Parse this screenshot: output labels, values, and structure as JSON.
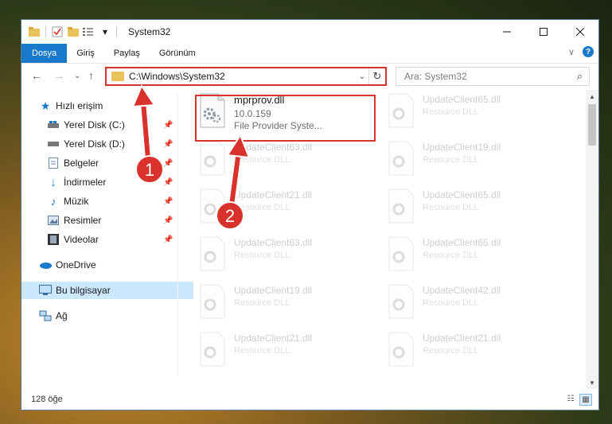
{
  "window": {
    "title": "System32"
  },
  "ribbon": {
    "tabs": [
      {
        "label": "Dosya"
      },
      {
        "label": "Giriş"
      },
      {
        "label": "Paylaş"
      },
      {
        "label": "Görünüm"
      }
    ],
    "help": "?"
  },
  "address": {
    "path": "C:\\Windows\\System32"
  },
  "search": {
    "placeholder": "Ara: System32"
  },
  "sidebar": {
    "quick_access": "Hızlı erişim",
    "items": [
      {
        "label": "Yerel Disk (C:)"
      },
      {
        "label": "Yerel Disk (D:)"
      },
      {
        "label": "Belgeler"
      },
      {
        "label": "İndirmeler"
      },
      {
        "label": "Müzik"
      },
      {
        "label": "Resimler"
      },
      {
        "label": "Videolar"
      }
    ],
    "onedrive": "OneDrive",
    "this_pc": "Bu bilgisayar",
    "network": "Ağ"
  },
  "files": {
    "main": {
      "name": "mprprov.dll",
      "version": "10.0.159",
      "description": "File Provider Syste..."
    },
    "ghosts_left": [
      {
        "name": "UpdateClient63.dll",
        "type": "Resource DLL"
      },
      {
        "name": "UpdateClient21.dll",
        "type": "Resource DLL"
      },
      {
        "name": "UpdateClient63.dll",
        "type": "Resource DLL"
      },
      {
        "name": "UpdateClient19.dll",
        "type": "Resource DLL"
      },
      {
        "name": "UpdateClient21.dll",
        "type": "Resource DLL"
      }
    ],
    "ghosts_right": [
      {
        "name": "UpdateClient65.dll",
        "type": "Resource DLL"
      },
      {
        "name": "UpdateClient19.dll",
        "type": "Resource DLL"
      },
      {
        "name": "UpdateClient65.dll",
        "type": "Resource DLL"
      },
      {
        "name": "UpdateClient65.dll",
        "type": "Resource DLL"
      },
      {
        "name": "UpdateClient42.dll",
        "type": "Resource DLL"
      },
      {
        "name": "UpdateClient21.dll",
        "type": "Resource DLL"
      }
    ]
  },
  "status": {
    "count": "128 öğe"
  },
  "annotations": {
    "step1": "1",
    "step2": "2"
  },
  "colors": {
    "accent": "#1979ca",
    "highlight": "#d9312b",
    "selected": "#cce8ff"
  }
}
